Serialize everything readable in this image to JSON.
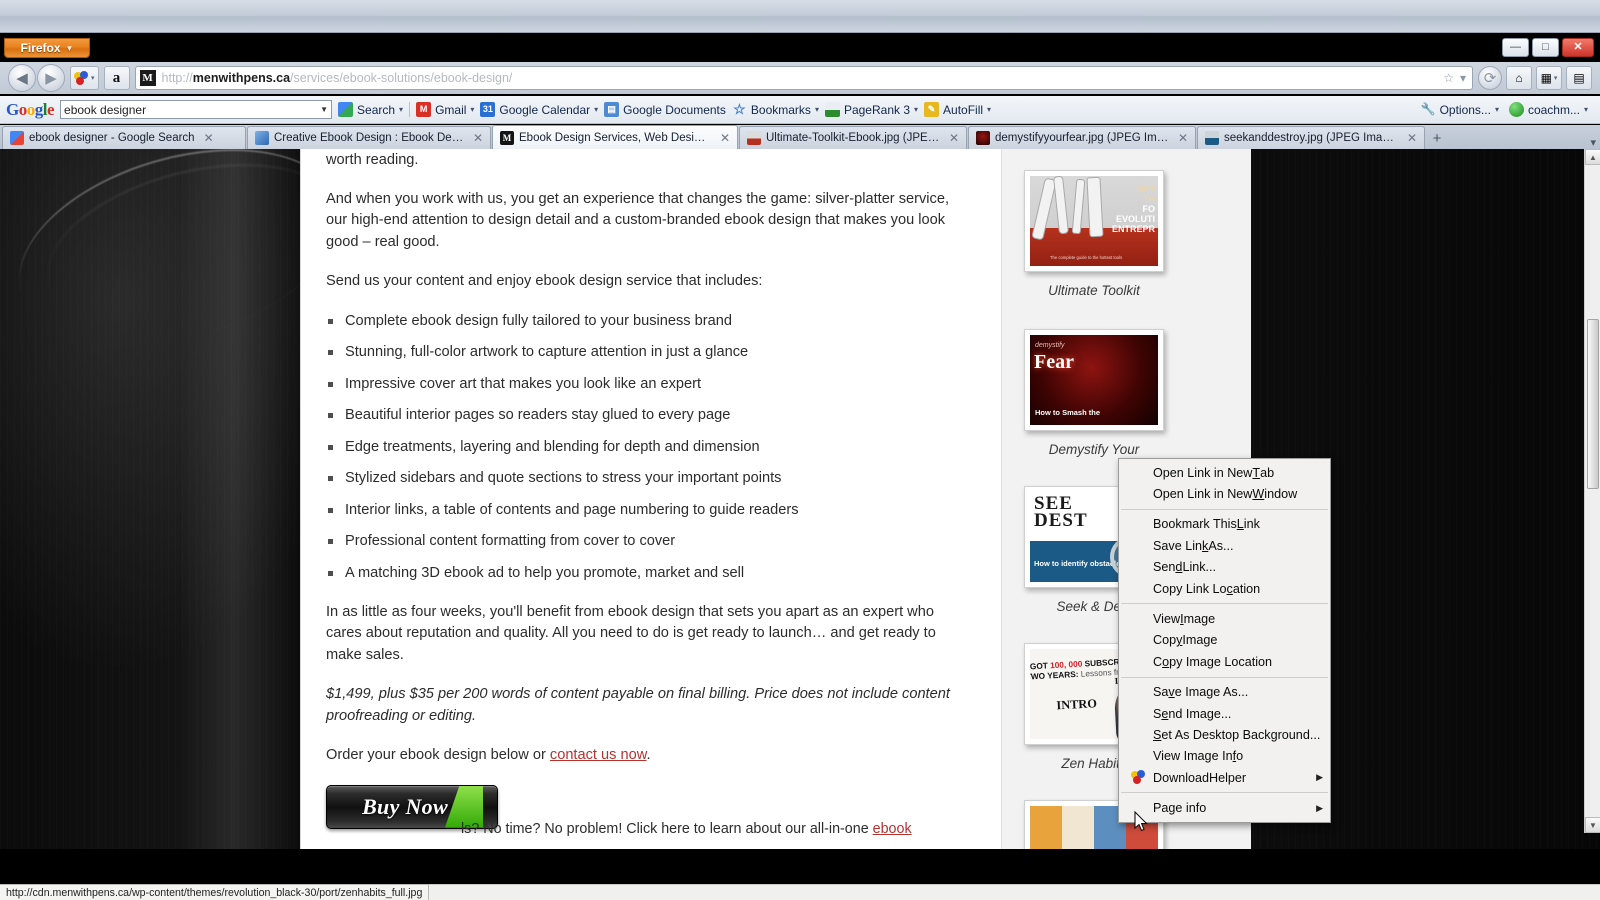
{
  "window": {
    "firefox_button": "Firefox",
    "minimize": "—",
    "maximize": "□",
    "close": "✕"
  },
  "navbar": {
    "back_icon": "◀",
    "forward_icon": "▶",
    "url": {
      "scheme": "http://",
      "domain": "menwithpens.ca",
      "path": "/services/ebook-solutions/ebook-design/",
      "favicon_letter": "M"
    },
    "amazon_label": "a",
    "bookmark_star": "☆",
    "home_icon": "⌂",
    "dropmarker": "▾"
  },
  "google_toolbar": {
    "logo": "Google",
    "search_value": "ebook designer",
    "search_dropdown": "▼",
    "items": [
      {
        "label": "Search",
        "icon": "google-icon",
        "caret": "▾"
      },
      {
        "label": "Gmail",
        "icon": "gmail-icon",
        "caret": "▾"
      },
      {
        "label": "Google Calendar",
        "icon": "calendar-icon",
        "icon_text": "31",
        "caret": "▾"
      },
      {
        "label": "Google Documents",
        "icon": "documents-icon"
      },
      {
        "label": "Bookmarks",
        "icon": "star-icon",
        "caret": "▾"
      },
      {
        "label": "PageRank 3",
        "icon": "pagerank-icon",
        "caret": "▾"
      },
      {
        "label": "AutoFill",
        "icon": "autofill-icon",
        "caret": "▾"
      }
    ],
    "options_label": "Options...",
    "options_caret": "▾",
    "account_label": "coachm...",
    "account_caret": "▾"
  },
  "tabs": [
    {
      "label": "ebook designer - Google Search",
      "favicon": "google-icon",
      "close": "✕",
      "active": false
    },
    {
      "label": "Creative Ebook Design : Ebook Desig...",
      "favicon": "site-icon",
      "close": "✕",
      "active": false
    },
    {
      "label": "Ebook Design Services, Web Design S...",
      "favicon": "menwithpens-icon",
      "close": "✕",
      "active": true
    },
    {
      "label": "Ultimate-Toolkit-Ebook.jpg (JPEG Im...",
      "favicon": "image-icon",
      "close": "✕",
      "active": false
    },
    {
      "label": "demystifyyourfear.jpg (JPEG Image, 7...",
      "favicon": "image-icon",
      "close": "✕",
      "active": false
    },
    {
      "label": "seekanddestroy.jpg (JPEG Image, 792...",
      "favicon": "image-icon",
      "close": "✕",
      "active": false
    }
  ],
  "new_tab_label": "+",
  "page": {
    "paragraphs": {
      "p0": "worth reading.",
      "p1": "And when you work with us, you get an experience that changes the game: silver-platter service, our high-end attention to design detail and a custom-branded ebook design that makes you look good – real good.",
      "p2": "Send us your content and enjoy ebook design service that includes:",
      "p3": "In as little as four weeks, you'll benefit from ebook design that sets you apart as an expert who cares about reputation and quality. All you need to do is get ready to launch… and get ready to make sales.",
      "p4": "$1,499, plus $35 per 200 words of content payable on final billing. Price does not include content proofreading or editing.",
      "p5_before": "Order your ebook design below or ",
      "p5_link": "contact us now",
      "p5_after": "."
    },
    "bullets": [
      "Complete ebook design fully tailored to your business brand",
      "Stunning, full-color artwork to capture attention in just a glance",
      "Impressive cover art that makes you look like an expert",
      "Beautiful interior pages so readers stay glued to every page",
      "Edge treatments, layering and blending for depth and dimension",
      "Stylized sidebars and quote sections to stress your important points",
      "Interior links, a table of contents and page numbering to guide readers",
      "Professional content formatting from cover to cover",
      "A matching 3D ebook ad to help you promote, market and sell"
    ],
    "buy_now_label": "Buy Now",
    "bottom_text_before": "ls? No time? No problem! Click here to learn about our all-in-one ",
    "bottom_text_link": "ebook"
  },
  "sidebar": {
    "thumbnails": [
      {
        "caption": "Ultimate Toolkit",
        "art": "toolkit",
        "title_line1": "GET",
        "title_line2": "TH",
        "title_line3": "FO",
        "title_line4": "EVOLUTI",
        "title_line5": "ENTREPR",
        "subtitle": "The complete guide to the hottest tools"
      },
      {
        "caption": "Demystify Your",
        "art": "demystify",
        "headline": "Fear",
        "small": "demystify",
        "bottom": "How to Smash the"
      },
      {
        "caption": "Seek & Dest",
        "art": "seek",
        "headline": "SEE DEST",
        "bottom": "How to identify obstacles and"
      },
      {
        "caption": "Zen Habits",
        "art": "zen",
        "line1_a": "I GOT ",
        "line1_red": "100, 000",
        "line1_b": " SUBSCRIBE",
        "line2_a": "TWO YEARS: ",
        "line2_b": "Lessons from Zen",
        "intro": "INTRO",
        "intro2": "INTRO:"
      },
      {
        "caption": "",
        "art": "colorful"
      }
    ]
  },
  "context_menu": {
    "groups": [
      [
        {
          "label_before": "Open Link in New ",
          "accel": "T",
          "label_after": "ab",
          "name": "open-link-new-tab"
        },
        {
          "label_before": "Open Link in New ",
          "accel": "W",
          "label_after": "indow",
          "name": "open-link-new-window"
        }
      ],
      [
        {
          "label_before": "Bookmark This ",
          "accel": "L",
          "label_after": "ink",
          "name": "bookmark-this-link"
        },
        {
          "label_before": "Save Lin",
          "accel": "k",
          "label_after": " As...",
          "name": "save-link-as"
        },
        {
          "label_before": "Sen",
          "accel": "d",
          "label_after": " Link...",
          "name": "send-link"
        },
        {
          "label_before": "Copy Link Lo",
          "accel": "c",
          "label_after": "ation",
          "name": "copy-link-location"
        }
      ],
      [
        {
          "label_before": "View ",
          "accel": "I",
          "label_after": "mage",
          "name": "view-image"
        },
        {
          "label_before": "Cop",
          "accel": "y",
          "label_after": " Image",
          "name": "copy-image"
        },
        {
          "label_before": "C",
          "accel": "o",
          "label_after": "py Image Location",
          "name": "copy-image-location"
        }
      ],
      [
        {
          "label_before": "Sa",
          "accel": "v",
          "label_after": "e Image As...",
          "name": "save-image-as"
        },
        {
          "label_before": "S",
          "accel": "e",
          "label_after": "nd Image...",
          "name": "send-image"
        },
        {
          "label_before": "",
          "accel": "S",
          "label_after": "et As Desktop Background...",
          "name": "set-as-desktop-background"
        },
        {
          "label_before": "View Image In",
          "accel": "f",
          "label_after": "o",
          "name": "view-image-info"
        },
        {
          "label_before": "DownloadHelper",
          "accel": "",
          "label_after": "",
          "name": "downloadhelper",
          "icon": "downloadhelper-icon",
          "submenu": "▶"
        }
      ],
      [
        {
          "label_before": "Page info",
          "accel": "",
          "label_after": "",
          "name": "page-info",
          "submenu": "▶"
        }
      ]
    ]
  },
  "status_bar": {
    "link_url": "http://cdn.menwithpens.ca/wp-content/themes/revolution_black-30/port/zenhabits_full.jpg"
  },
  "scrollbar": {
    "up": "▲",
    "down": "▼"
  }
}
